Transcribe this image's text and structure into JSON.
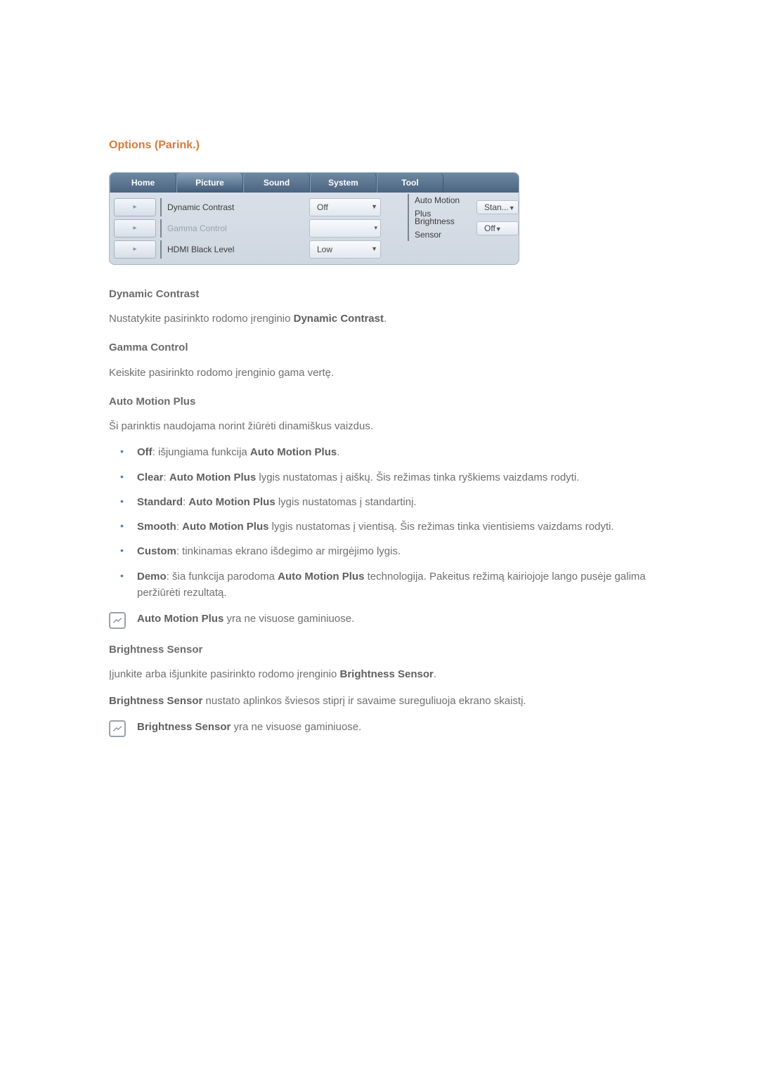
{
  "section_title": "Options (Parink.)",
  "tabs": {
    "home": "Home",
    "picture": "Picture",
    "sound": "Sound",
    "system": "System",
    "tool": "Tool"
  },
  "panel": {
    "row1": {
      "label": "Dynamic Contrast",
      "value": "Off",
      "label2": "Auto Motion Plus",
      "value2": "Stan..."
    },
    "row2": {
      "label": "Gamma Control",
      "value": "",
      "label2": "Brightness Sensor",
      "value2": "Off"
    },
    "row3": {
      "label": "HDMI Black Level",
      "value": "Low"
    }
  },
  "dynamic_contrast": {
    "heading": "Dynamic Contrast",
    "p1a": "Nustatykite pasirinkto rodomo įrenginio ",
    "p1b": "Dynamic Contrast",
    "p1c": "."
  },
  "gamma_control": {
    "heading": "Gamma Control",
    "p1": "Keiskite pasirinkto rodomo įrenginio gama vertę."
  },
  "auto_motion_plus": {
    "heading": "Auto Motion Plus",
    "intro": "Ši parinktis naudojama norint žiūrėti dinamiškus vaizdus.",
    "li_off_b": "Off",
    "li_off_t": ": išjungiama funkcija ",
    "li_off_b2": "Auto Motion Plus",
    "li_off_t2": ".",
    "li_clear_b": "Clear",
    "li_clear_t": ": ",
    "li_clear_b2": "Auto Motion Plus",
    "li_clear_t2": " lygis nustatomas į aiškų. Šis režimas tinka ryškiems vaizdams rodyti.",
    "li_std_b": "Standard",
    "li_std_t": ": ",
    "li_std_b2": "Auto Motion Plus",
    "li_std_t2": " lygis nustatomas į standartinį.",
    "li_smooth_b": "Smooth",
    "li_smooth_t": ": ",
    "li_smooth_b2": "Auto Motion Plus",
    "li_smooth_t2": " lygis nustatomas į vientisą. Šis režimas tinka vientisiems vaizdams rodyti.",
    "li_custom_b": "Custom",
    "li_custom_t": ": tinkinamas ekrano išdegimo ar mirgėjimo lygis.",
    "li_demo_b": "Demo",
    "li_demo_t": ": šia funkcija parodoma ",
    "li_demo_b2": "Auto Motion Plus",
    "li_demo_t2": " technologija. Pakeitus režimą kairiojoje lango pusėje galima peržiūrėti rezultatą.",
    "note_b": "Auto Motion Plus",
    "note_t": "  yra ne visuose gaminiuose."
  },
  "brightness_sensor": {
    "heading": "Brightness Sensor",
    "p1a": "Įjunkite arba išjunkite pasirinkto rodomo įrenginio ",
    "p1b": "Brightness Sensor",
    "p1c": ".",
    "p2b": "Brightness Sensor",
    "p2t": " nustato aplinkos šviesos stiprį ir savaime sureguliuoja ekrano skaistį.",
    "note_b": "Brightness Sensor",
    "note_t": " yra ne visuose gaminiuose."
  }
}
